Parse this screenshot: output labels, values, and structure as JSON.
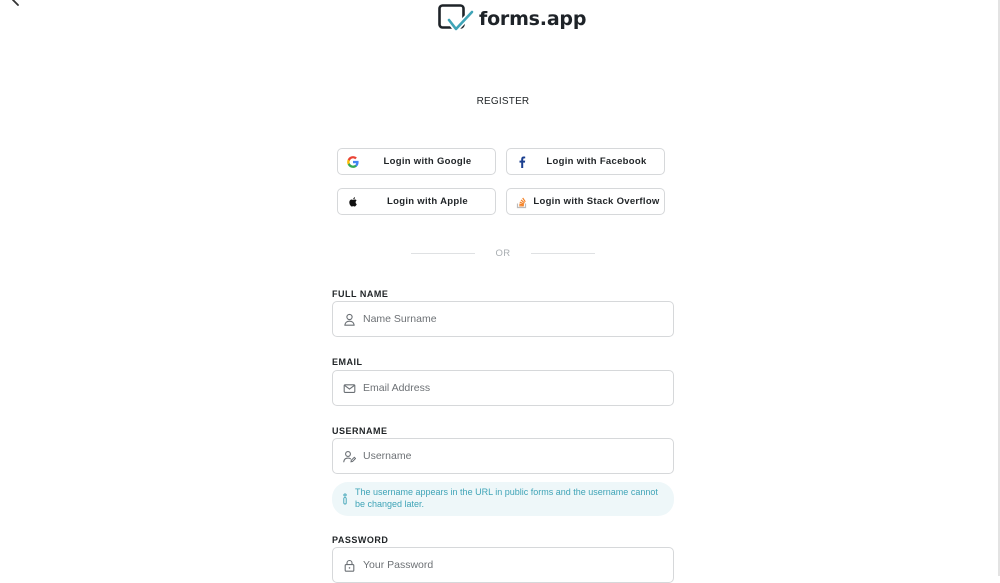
{
  "brand": {
    "name": "forms.app"
  },
  "page": {
    "title": "REGISTER"
  },
  "social": [
    {
      "label": "Login with Google",
      "icon": "google-icon"
    },
    {
      "label": "Login with Facebook",
      "icon": "facebook-icon"
    },
    {
      "label": "Login with Apple",
      "icon": "apple-icon"
    },
    {
      "label": "Login with Stack Overflow",
      "icon": "stack-overflow-icon"
    }
  ],
  "divider": {
    "text": "OR"
  },
  "form": {
    "full_name": {
      "label": "FULL NAME",
      "placeholder": "Name Surname",
      "value": ""
    },
    "email": {
      "label": "EMAIL",
      "placeholder": "Email Address",
      "value": ""
    },
    "username": {
      "label": "USERNAME",
      "placeholder": "Username",
      "value": "",
      "info": "The username appears in the URL in public forms and the username cannot be changed later."
    },
    "password": {
      "label": "PASSWORD",
      "placeholder": "Your Password",
      "value": ""
    }
  },
  "colors": {
    "accent": "#3fa4b7",
    "info_bg": "#eef7f9",
    "border": "#d6d8da",
    "text": "#1f2326",
    "facebook": "#1877f2",
    "stack_overflow": "#f48024"
  }
}
